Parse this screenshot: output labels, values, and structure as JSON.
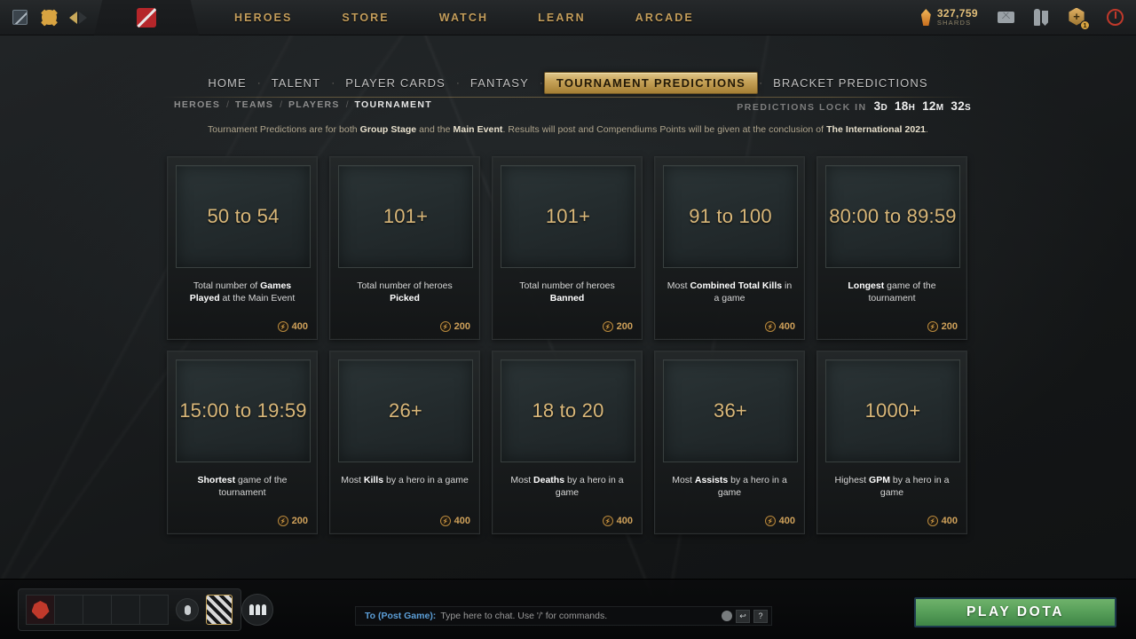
{
  "topbar": {
    "icons": {
      "dota_small": "dota-logo-icon",
      "settings": "gear-icon",
      "back": "back-arrow-icon",
      "forward": "forward-arrow-icon",
      "logo": "dota-logo-red-icon",
      "mail": "mail-icon",
      "armory": "armory-icon",
      "quests": "quests-hex-icon",
      "power": "power-icon"
    },
    "nav": [
      "HEROES",
      "STORE",
      "WATCH",
      "LEARN",
      "ARCADE"
    ],
    "shards": {
      "amount": "327,759",
      "label": "SHARDS"
    },
    "quest_badge_count": "1",
    "quest_hex_glyph": "+"
  },
  "tabs": [
    {
      "label": "HOME",
      "active": false
    },
    {
      "label": "TALENT",
      "active": false
    },
    {
      "label": "PLAYER CARDS",
      "active": false
    },
    {
      "label": "FANTASY",
      "active": false
    },
    {
      "label": "TOURNAMENT PREDICTIONS",
      "active": true
    },
    {
      "label": "BRACKET PREDICTIONS",
      "active": false
    }
  ],
  "tab_separator": "·",
  "breadcrumb": {
    "items": [
      {
        "label": "HEROES",
        "current": false
      },
      {
        "label": "TEAMS",
        "current": false
      },
      {
        "label": "PLAYERS",
        "current": false
      },
      {
        "label": "TOURNAMENT",
        "current": true
      }
    ],
    "separator": "/"
  },
  "lock_timer": {
    "label": "PREDICTIONS LOCK IN",
    "segments": [
      {
        "value": "3",
        "unit": "D"
      },
      {
        "value": "18",
        "unit": "H"
      },
      {
        "value": "12",
        "unit": "M"
      },
      {
        "value": "32",
        "unit": "S"
      }
    ]
  },
  "info_line": {
    "part1": "Tournament Predictions are for both ",
    "bold1": "Group Stage",
    "part2": " and the ",
    "bold2": "Main Event",
    "part3": ". Results will post and Compendiums Points will be given at the conclusion of ",
    "bold3": "The International 2021",
    "part4": "."
  },
  "cards": [
    {
      "value": "50 to 54",
      "desc_pre": "Total number of ",
      "desc_bold": "Games Played",
      "desc_post": " at the Main Event",
      "points": "400"
    },
    {
      "value": "101+",
      "desc_pre": "Total number of heroes ",
      "desc_bold": "Picked",
      "desc_post": "",
      "points": "200"
    },
    {
      "value": "101+",
      "desc_pre": "Total number of heroes ",
      "desc_bold": "Banned",
      "desc_post": "",
      "points": "200"
    },
    {
      "value": "91 to 100",
      "desc_pre": "Most ",
      "desc_bold": "Combined Total Kills",
      "desc_post": " in a game",
      "points": "400"
    },
    {
      "value": "80:00 to 89:59",
      "desc_pre": "",
      "desc_bold": "Longest",
      "desc_post": " game of the tournament",
      "points": "200"
    },
    {
      "value": "15:00 to 19:59",
      "desc_pre": "",
      "desc_bold": "Shortest",
      "desc_post": " game of the tournament",
      "points": "200"
    },
    {
      "value": "26+",
      "desc_pre": "Most ",
      "desc_bold": "Kills",
      "desc_post": " by a hero in a game",
      "points": "400"
    },
    {
      "value": "18 to 20",
      "desc_pre": "Most ",
      "desc_bold": "Deaths",
      "desc_post": " by a hero in a game",
      "points": "400"
    },
    {
      "value": "36+",
      "desc_pre": "Most ",
      "desc_bold": "Assists",
      "desc_post": " by a hero in a game",
      "points": "400"
    },
    {
      "value": "1000+",
      "desc_pre": "Highest ",
      "desc_bold": "GPM",
      "desc_post": " by a hero in a game",
      "points": "400"
    }
  ],
  "bottom": {
    "party_slots": 5,
    "chat": {
      "to_label": "To (Post Game):",
      "placeholder": "Type here to chat. Use '/' for commands.",
      "help_glyph": "?",
      "reply_glyph": "↩"
    },
    "play_button": "PLAY DOTA"
  },
  "colors": {
    "accent_gold": "#c39d5b",
    "value_gold": "#d9b779",
    "points_gold": "#cfa15a",
    "play_green": "#58a05a",
    "chat_blue": "#5c9fd8"
  }
}
